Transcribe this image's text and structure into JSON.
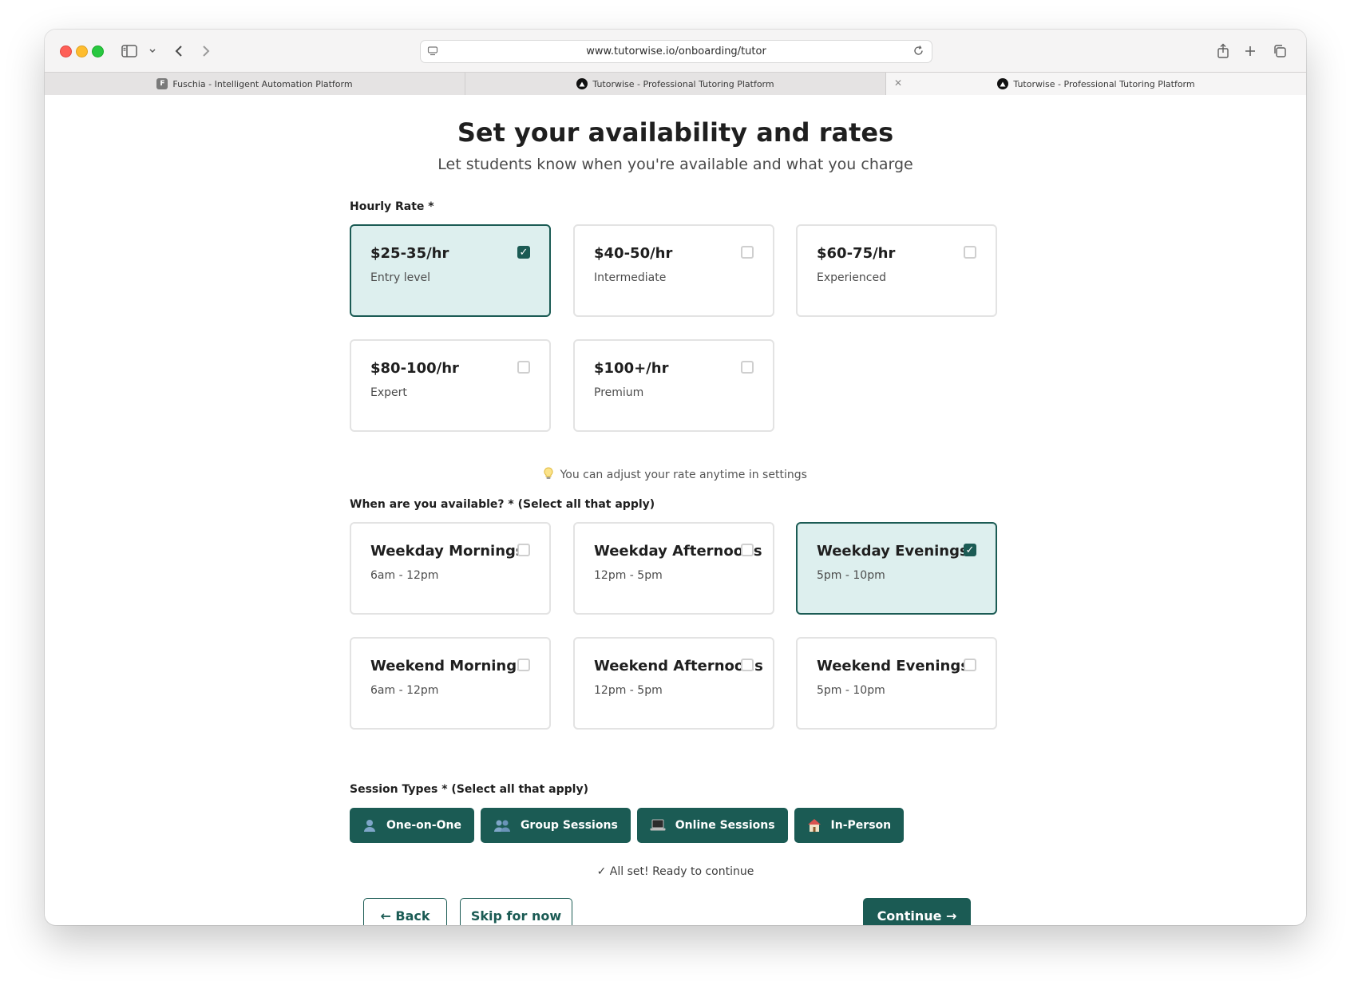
{
  "browser": {
    "url": "www.tutorwise.io/onboarding/tutor",
    "tabs": [
      {
        "label": "Fuschia - Intelligent Automation Platform",
        "favicon": "F"
      },
      {
        "label": "Tutorwise - Professional Tutoring Platform"
      },
      {
        "label": "Tutorwise - Professional Tutoring Platform"
      }
    ]
  },
  "page": {
    "title": "Set your availability and rates",
    "subtitle": "Let students know when you're available and what you charge"
  },
  "rates": {
    "label": "Hourly Rate *",
    "options": [
      {
        "title": "$25-35/hr",
        "subtitle": "Entry level",
        "checked": true
      },
      {
        "title": "$40-50/hr",
        "subtitle": "Intermediate",
        "checked": false
      },
      {
        "title": "$60-75/hr",
        "subtitle": "Experienced",
        "checked": false
      },
      {
        "title": "$80-100/hr",
        "subtitle": "Expert",
        "checked": false
      },
      {
        "title": "$100+/hr",
        "subtitle": "Premium",
        "checked": false
      }
    ],
    "tip": "You can adjust your rate anytime in settings"
  },
  "availability": {
    "label": "When are you available? * (Select all that apply)",
    "options": [
      {
        "title": "Weekday Mornings",
        "subtitle": "6am - 12pm",
        "checked": false
      },
      {
        "title": "Weekday Afternoons",
        "subtitle": "12pm - 5pm",
        "checked": false
      },
      {
        "title": "Weekday Evenings",
        "subtitle": "5pm - 10pm",
        "checked": true
      },
      {
        "title": "Weekend Mornings",
        "subtitle": "6am - 12pm",
        "checked": false
      },
      {
        "title": "Weekend Afternoons",
        "subtitle": "12pm - 5pm",
        "checked": false
      },
      {
        "title": "Weekend Evenings",
        "subtitle": "5pm - 10pm",
        "checked": false
      }
    ]
  },
  "session_types": {
    "label": "Session Types * (Select all that apply)",
    "options": [
      {
        "label": "One-on-One",
        "icon": "person-icon"
      },
      {
        "label": "Group Sessions",
        "icon": "people-icon"
      },
      {
        "label": "Online Sessions",
        "icon": "laptop-icon"
      },
      {
        "label": "In-Person",
        "icon": "house-icon"
      }
    ]
  },
  "status": "✓ All set! Ready to continue",
  "actions": {
    "back": "← Back",
    "skip": "Skip for now",
    "continue": "Continue →"
  },
  "colors": {
    "accent": "#1b5b54",
    "selected_bg": "#ddefee"
  }
}
